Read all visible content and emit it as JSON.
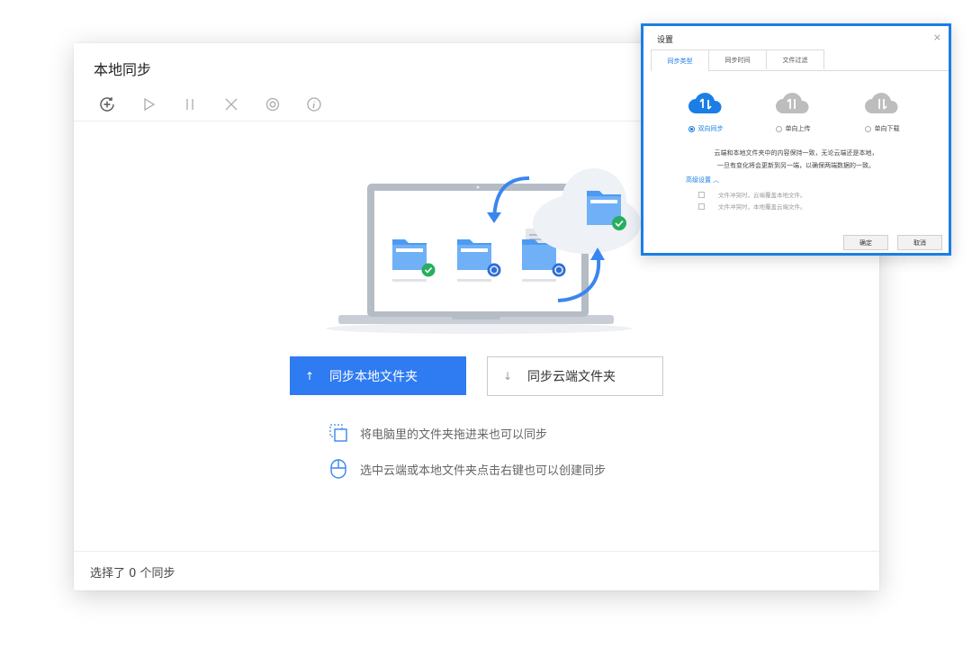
{
  "window": {
    "title": "本地同步",
    "toolbar": [
      {
        "name": "add-sync-icon"
      },
      {
        "name": "start-icon"
      },
      {
        "name": "pause-icon"
      },
      {
        "name": "delete-icon"
      },
      {
        "name": "settings-icon"
      },
      {
        "name": "info-icon"
      }
    ],
    "primary_button": {
      "arrow": "↑",
      "label": "同步本地文件夹"
    },
    "secondary_button": {
      "arrow": "↓",
      "label": "同步云端文件夹"
    },
    "hints": [
      {
        "icon": "drag-folder-icon",
        "text": "将电脑里的文件夹拖进来也可以同步"
      },
      {
        "icon": "mouse-icon",
        "text": "选中云端或本地文件夹点击右键也可以创建同步"
      }
    ],
    "status": "选择了 0 个同步"
  },
  "dialog": {
    "title": "设置",
    "close": "×",
    "tabs": [
      "同步类型",
      "同步时间",
      "文件过滤"
    ],
    "active_tab": 0,
    "options": [
      {
        "label": "双向同步",
        "selected": true,
        "color": "#1a7ee6"
      },
      {
        "label": "单向上传",
        "selected": false,
        "color": "#bdbdbd"
      },
      {
        "label": "单向下载",
        "selected": false,
        "color": "#bdbdbd"
      }
    ],
    "description_line1": "云端和本地文件夹中的内容保持一致，无论云端还是本地，",
    "description_line2": "一旦有变化将会更新到另一端，以确保两端数据的一致。",
    "advanced": "高级设置 ︿",
    "checkboxes": [
      "文件冲突时，云端覆盖本地文件。",
      "文件冲突时，本地覆盖云端文件。"
    ],
    "ok": "确定",
    "cancel": "取消"
  },
  "colors": {
    "accent": "#2f7bf1",
    "dialog_border": "#1a7ee6",
    "check_green": "#27ae60"
  }
}
